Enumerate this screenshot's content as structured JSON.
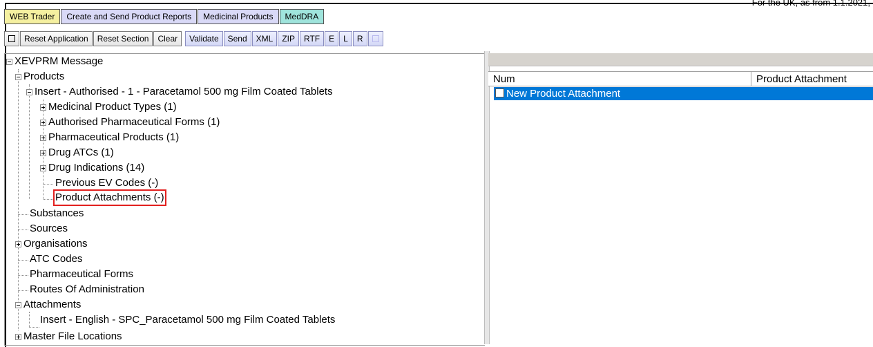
{
  "top_note": "For the UK, as from 1.1.2021,",
  "nav": {
    "web_trader": "WEB Trader",
    "reports": "Create and Send Product Reports",
    "medicinal": "Medicinal Products",
    "meddra": "MedDRA"
  },
  "toolbar": {
    "reset_application": "Reset Application",
    "reset_section": "Reset Section",
    "clear": "Clear",
    "validate": "Validate",
    "send": "Send",
    "xml": "XML",
    "zip": "ZIP",
    "rtf": "RTF",
    "e": "E",
    "l": "L",
    "r": "R"
  },
  "tree": {
    "root": "XEVPRM Message",
    "products": "Products",
    "insert_product": "Insert - Authorised - 1 - Paracetamol 500 mg Film Coated Tablets",
    "medicinal_product_types": "Medicinal Product Types (1)",
    "authorised_pharma_forms": "Authorised Pharmaceutical Forms (1)",
    "pharma_products": "Pharmaceutical Products (1)",
    "drug_atcs": "Drug ATCs (1)",
    "drug_indications": "Drug Indications (14)",
    "previous_ev_codes": "Previous EV Codes (-)",
    "product_attachments": "Product Attachments (-)",
    "substances": "Substances",
    "sources": "Sources",
    "organisations": "Organisations",
    "atc_codes": "ATC Codes",
    "pharmaceutical_forms": "Pharmaceutical Forms",
    "routes_of_administration": "Routes Of Administration",
    "attachments": "Attachments",
    "insert_attachment": "Insert - English - SPC_Paracetamol 500 mg Film Coated Tablets",
    "master_file_locations": "Master File Locations"
  },
  "grid": {
    "col_num": "Num",
    "col_attachment": "Product Attachment",
    "row_new": "New Product Attachment"
  },
  "colors": {
    "highlight": "#e2201e",
    "selection": "#0078d7"
  }
}
